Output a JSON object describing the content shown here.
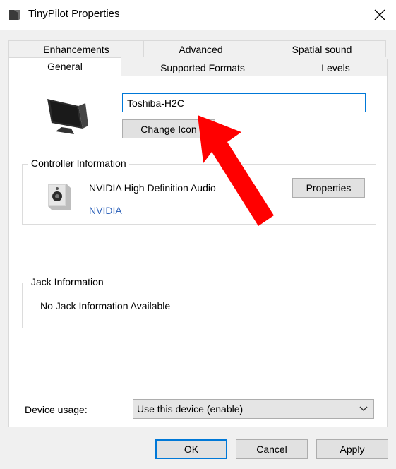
{
  "window": {
    "title": "TinyPilot Properties",
    "icon": "speaker-icon",
    "close_icon": "close-icon"
  },
  "tabs": {
    "row_top": [
      {
        "label": "Enhancements"
      },
      {
        "label": "Advanced"
      },
      {
        "label": "Spatial sound"
      }
    ],
    "row_bottom": [
      {
        "label": "General",
        "active": true
      },
      {
        "label": "Supported Formats"
      },
      {
        "label": "Levels"
      }
    ]
  },
  "general": {
    "device_name": "Toshiba-H2C",
    "change_icon_label": "Change Icon",
    "device_icon": "monitor-icon"
  },
  "controller": {
    "group_label": "Controller Information",
    "name": "NVIDIA High Definition Audio",
    "vendor": "NVIDIA",
    "properties_label": "Properties",
    "vendor_color": "#3366bb"
  },
  "jack": {
    "group_label": "Jack Information",
    "text": "No Jack Information Available"
  },
  "device_usage": {
    "label": "Device usage:",
    "selected": "Use this device (enable)"
  },
  "buttons": {
    "ok": "OK",
    "cancel": "Cancel",
    "apply": "Apply"
  },
  "colors": {
    "accent": "#0078d7",
    "annotation_arrow": "#ff0000"
  }
}
